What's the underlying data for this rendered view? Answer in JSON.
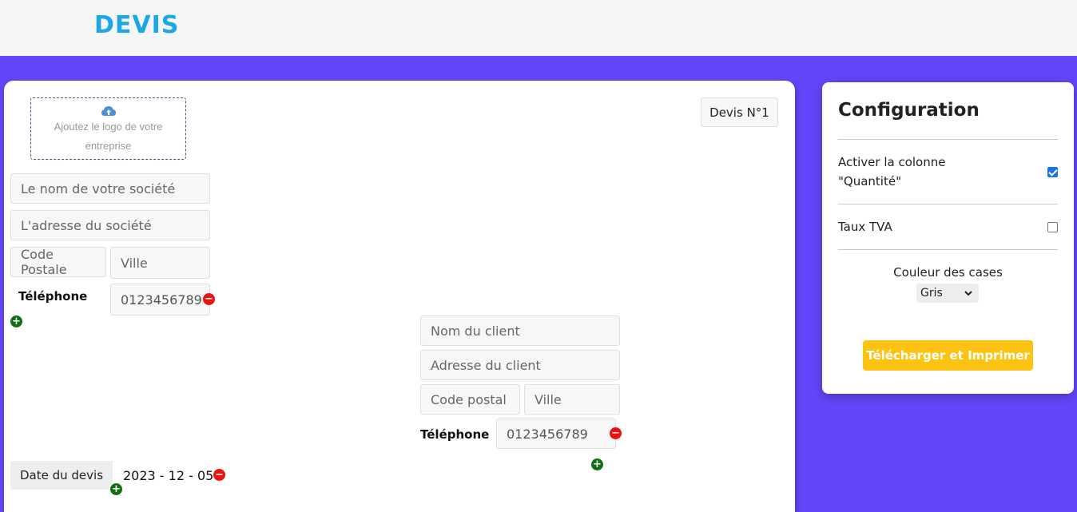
{
  "app": {
    "brand": "DEVIS"
  },
  "company": {
    "logo_placeholder": "Ajoutez le logo de votre entreprise",
    "name_placeholder": "Le nom de votre société",
    "address_placeholder": "L'adresse du société",
    "postal_placeholder": "Code Postale",
    "city_placeholder": "Ville",
    "phone_label": "Téléphone",
    "phone_value": "0123456789",
    "add_icon": "plus-circle-icon",
    "remove_icon": "minus-circle-icon"
  },
  "quote": {
    "number_label": "Devis N°1",
    "date_label": "Date du devis",
    "date_value": "2023 - 12 - 05"
  },
  "client": {
    "name_placeholder": "Nom du client",
    "address_placeholder": "Adresse du client",
    "postal_placeholder": "Code postal",
    "city_placeholder": "Ville",
    "phone_label": "Téléphone",
    "phone_value": "0123456789"
  },
  "config": {
    "title": "Configuration",
    "quantity_label_line1": "Activer la colonne",
    "quantity_label_line2": "\"Quantité\"",
    "quantity_checked": true,
    "tva_label": "Taux TVA",
    "tva_checked": false,
    "color_label": "Couleur des cases",
    "color_selected": "Gris",
    "download_button": "Télécharger et Imprimer"
  },
  "colors": {
    "accent": "#6346fb",
    "brand": "#1ea7e7",
    "button": "#fcc312",
    "add": "#127012",
    "remove": "#ee1111"
  }
}
